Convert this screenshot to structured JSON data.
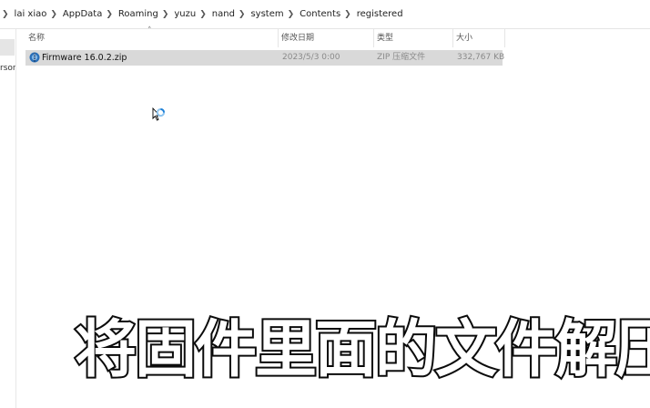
{
  "breadcrumb": [
    "lai xiao",
    "AppData",
    "Roaming",
    "yuzu",
    "nand",
    "system",
    "Contents",
    "registered"
  ],
  "nav": {
    "partial_label": "rsona"
  },
  "columns": {
    "name": "名称",
    "date": "修改日期",
    "type": "类型",
    "size": "大小"
  },
  "file": {
    "name": "Firmware 16.0.2.zip",
    "date": "2023/5/3 0:00",
    "type": "ZIP 压缩文件",
    "size": "332,767 KB"
  },
  "caption": "将固件里面的文件解压",
  "icons": {
    "file": "zip-archive-icon",
    "cursor": "busy-cursor-icon",
    "sort": "chevron-up-icon",
    "separator": "chevron-right-icon"
  },
  "colors": {
    "selected_row": "#d9d9d9",
    "caption_fill": "#ffffff",
    "caption_stroke": "#111111"
  }
}
